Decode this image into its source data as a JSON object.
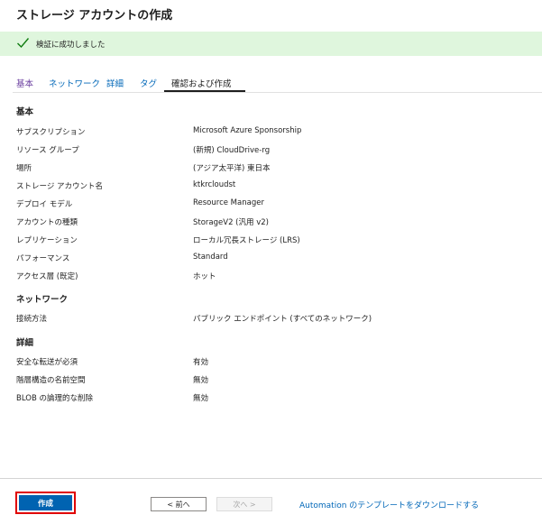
{
  "page": {
    "title": "ストレージ アカウントの作成"
  },
  "banner": {
    "text": "検証に成功しました",
    "icon": "check-icon",
    "color": "#dff6dd"
  },
  "tabs": [
    {
      "label": "基本"
    },
    {
      "label": "ネットワーク"
    },
    {
      "label": "詳細"
    },
    {
      "label": "タグ"
    },
    {
      "label": "確認および作成",
      "active": true
    }
  ],
  "sections": {
    "basics": {
      "header": "基本",
      "rows": [
        {
          "label": "サブスクリプション",
          "value": "Microsoft Azure Sponsorship"
        },
        {
          "label": "リソース グループ",
          "value": "(新規) CloudDrive-rg"
        },
        {
          "label": "場所",
          "value": "(アジア太平洋) 東日本"
        },
        {
          "label": "ストレージ アカウント名",
          "value": "ktkrcloudst"
        },
        {
          "label": "デプロイ モデル",
          "value": "Resource Manager"
        },
        {
          "label": "アカウントの種類",
          "value": "StorageV2 (汎用 v2)"
        },
        {
          "label": "レプリケーション",
          "value": "ローカル冗長ストレージ (LRS)"
        },
        {
          "label": "パフォーマンス",
          "value": "Standard"
        },
        {
          "label": "アクセス層 (既定)",
          "value": "ホット"
        }
      ]
    },
    "network": {
      "header": "ネットワーク",
      "rows": [
        {
          "label": "接続方法",
          "value": "パブリック エンドポイント (すべてのネットワーク)"
        }
      ]
    },
    "advanced": {
      "header": "詳細",
      "rows": [
        {
          "label": "安全な転送が必須",
          "value": "有効"
        },
        {
          "label": "階層構造の名前空間",
          "value": "無効"
        },
        {
          "label": "BLOB の論理的な削除",
          "value": "無効"
        }
      ]
    }
  },
  "footer": {
    "create_label": "作成",
    "prev_label": "< 前へ",
    "next_label": "次へ >",
    "template_link": "Automation のテンプレートをダウンロードする"
  },
  "colors": {
    "accent": "#0063b1",
    "link": "#0067b8",
    "highlight": "#e00000"
  }
}
